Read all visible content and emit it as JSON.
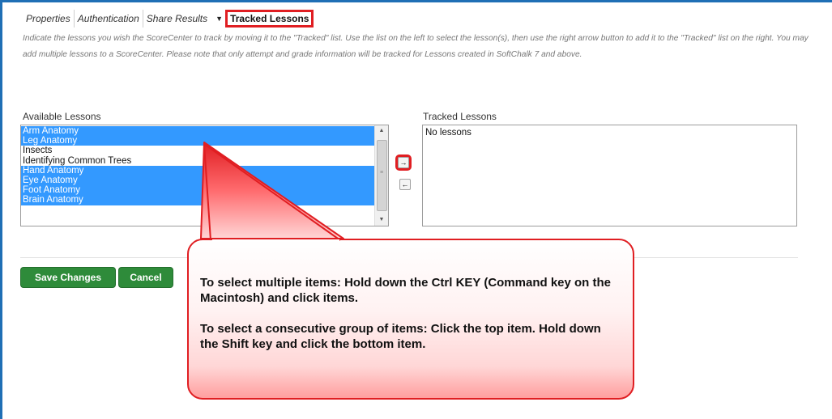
{
  "tabs": {
    "items": [
      "Properties",
      "Authentication",
      "Share Results"
    ],
    "active": "Tracked Lessons"
  },
  "instructions": "Indicate the lessons you wish the ScoreCenter to track by moving it to the \"Tracked\" list. Use the list on the left to select the lesson(s), then use the right arrow button to add it to the \"Tracked\" list on the right. You may add multiple lessons to a ScoreCenter. Please note that only attempt and grade information will be tracked for Lessons created in SoftChalk 7 and above.",
  "available": {
    "label": "Available Lessons",
    "options": [
      {
        "text": "Arm Anatomy",
        "selected": true
      },
      {
        "text": "Leg Anatomy",
        "selected": true
      },
      {
        "text": "Insects",
        "selected": false
      },
      {
        "text": "Identifying Common Trees",
        "selected": false
      },
      {
        "text": "Hand Anatomy",
        "selected": true
      },
      {
        "text": "Eye Anatomy",
        "selected": true
      },
      {
        "text": "Foot Anatomy",
        "selected": true
      },
      {
        "text": "Brain Anatomy",
        "selected": true
      }
    ]
  },
  "tracked": {
    "label": "Tracked Lessons",
    "empty_text": "No lessons"
  },
  "move_buttons": {
    "right_icon": "arrow-right-icon",
    "left_icon": "arrow-left-icon",
    "right_glyph": "→",
    "left_glyph": "←"
  },
  "buttons": {
    "save": "Save Changes",
    "cancel": "Cancel"
  },
  "callout": {
    "line1": "To select multiple items: Hold down the Ctrl KEY (Command key on the Macintosh) and click items.",
    "line2": "To select a consecutive group of items: Click the top item. Hold down the Shift key and click the bottom item."
  },
  "colors": {
    "selection": "#3399ff",
    "highlight_border": "#e01e22",
    "button_green": "#2e8b3a",
    "frame_blue": "#1f6fb5"
  }
}
